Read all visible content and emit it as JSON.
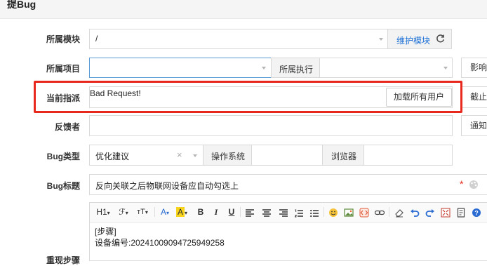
{
  "page": {
    "title": "提Bug"
  },
  "module": {
    "label": "所属模块",
    "value": "/",
    "maintain_label": "维护模块"
  },
  "project": {
    "label": "所属项目",
    "value": "",
    "execution_label": "所属执行",
    "execution_value": "",
    "affect_label": "影响版本"
  },
  "assign": {
    "label": "当前指派",
    "value": "Bad Request!",
    "load_all_label": "加载所有用户",
    "deadline_label": "截止日期"
  },
  "feedback": {
    "label": "反馈者",
    "value": "",
    "notify_label": "通知邮件"
  },
  "type": {
    "label": "Bug类型",
    "value": "优化建议",
    "os_label": "操作系统",
    "browser_label": "浏览器"
  },
  "bugtitle": {
    "label": "Bug标题",
    "value": "反向关联之后物联网设备应自动勾选上",
    "required_mark": "*"
  },
  "steps": {
    "label": "重现步骤",
    "toolbar": {
      "heading": "H1",
      "font": "ℱ",
      "fontsize": "тT"
    },
    "lines": [
      "[步骤]",
      "设备编号:20241009094725949258"
    ]
  },
  "colors": {
    "highlight": "#e8281d",
    "link": "#1a6fd6",
    "addon_bg": "#f3f3f3",
    "topbar_bg": "#f5f5f5"
  }
}
